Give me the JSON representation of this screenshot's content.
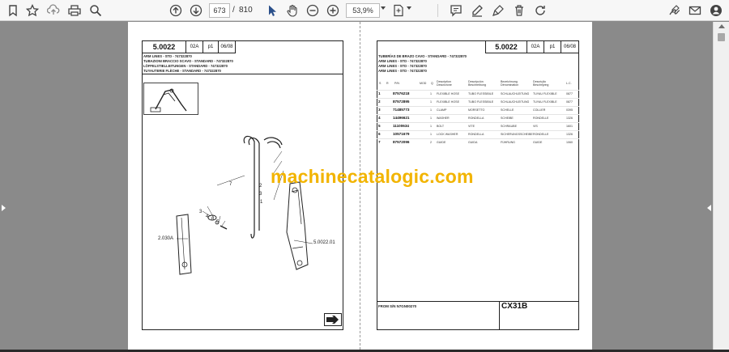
{
  "toolbar": {
    "page_current": "673",
    "page_separator": "/",
    "page_total": "810",
    "zoom": "53,9%",
    "icons": [
      "bookmark-icon",
      "star-icon",
      "upload-icon",
      "print-icon",
      "zoom-search-icon",
      "prev-page-icon",
      "next-page-icon",
      "cursor-icon",
      "hand-icon",
      "zoom-out-icon",
      "zoom-in-icon",
      "fit-page-icon",
      "comment-icon",
      "pen-icon",
      "highlight-icon",
      "delete-icon",
      "rotate-icon",
      "sign-icon",
      "mail-icon",
      "account-icon"
    ]
  },
  "left_page": {
    "code": "5.0022",
    "rev": "02A",
    "part": "p1",
    "date": "06/08",
    "titles": [
      "ARM LINES - STD - 747322870",
      "TUBAZIONI BRACCIO SCAVO - STANDARD - 747322870",
      "LÖFFELSTIELLEITUNGEN - STANDARD - 747322870",
      "TUYAUTERIE FLÈCHE - STANDARD - 747322870"
    ],
    "callouts": [
      "7",
      "2",
      "3",
      "1",
      "3",
      "4",
      "6",
      "5"
    ],
    "ref_left": "2.030A",
    "ref_right": "5.0022.01"
  },
  "right_page": {
    "code": "5.0022",
    "rev": "02A",
    "part": "p1",
    "date": "06/08",
    "titles": [
      "TUBERÍAS DE BRAZO CAVO - STANDARD - 747322870",
      "ARM LINES - STD - 747322870",
      "ARM LINES - STD - 747322870",
      "ARM LINES - STD - 747322870"
    ],
    "columns": [
      "S",
      "R",
      "P/N",
      "MOD",
      "Q",
      "Description Descrizione",
      "Descripción Beschreibung",
      "Bezeichnung Dénomination",
      "Descrição Beschrijving",
      "L.C."
    ],
    "rows": [
      {
        "ref": "1",
        "pn": "87576218",
        "q": "1",
        "d1": "FLEXIBLE HOSE",
        "d2": "TUBO FLESSIBILE",
        "d3": "SCHLAUCHLEITUNG",
        "d4": "TUYAU FLEXIBLE",
        "lc": "0877"
      },
      {
        "ref": "2",
        "pn": "87572895",
        "q": "1",
        "d1": "FLEXIBLE HOSE",
        "d2": "TUBO FLESSIBILE",
        "d3": "SCHLAUCHLEITUNG",
        "d4": "TUYAU FLEXIBLE",
        "lc": "0877"
      },
      {
        "ref": "3",
        "pn": "71485773",
        "q": "1",
        "d1": "CLAMP",
        "d2": "MORSETTO",
        "d3": "SCHELLE",
        "d4": "COLLIER",
        "lc": "0395"
      },
      {
        "ref": "4",
        "pn": "14496621",
        "q": "1",
        "d1": "WASHER",
        "d2": "RONDELLA",
        "d3": "SCHEIBE",
        "d4": "RONDELLE",
        "lc": "1326"
      },
      {
        "ref": "5",
        "pn": "11100634",
        "q": "1",
        "d1": "BOLT",
        "d2": "VITE",
        "d3": "SCHRAUBE",
        "d4": "VIS",
        "lc": "1601"
      },
      {
        "ref": "6",
        "pn": "10571679",
        "q": "1",
        "d1": "LOCK WASHER",
        "d2": "RONDELLA",
        "d3": "SICHERUNGSSCHEIBE",
        "d4": "RONDELLE",
        "lc": "1326"
      },
      {
        "ref": "7",
        "pn": "87572096",
        "q": "2",
        "d1": "GUIDE",
        "d2": "GUIDA",
        "d3": "FÜHRUNG",
        "d4": "GUIDE",
        "lc": "1060"
      }
    ],
    "from_sn": "FROM S/N N7GN00270",
    "model": "CX31B"
  },
  "watermark": "machinecatalogic.com"
}
